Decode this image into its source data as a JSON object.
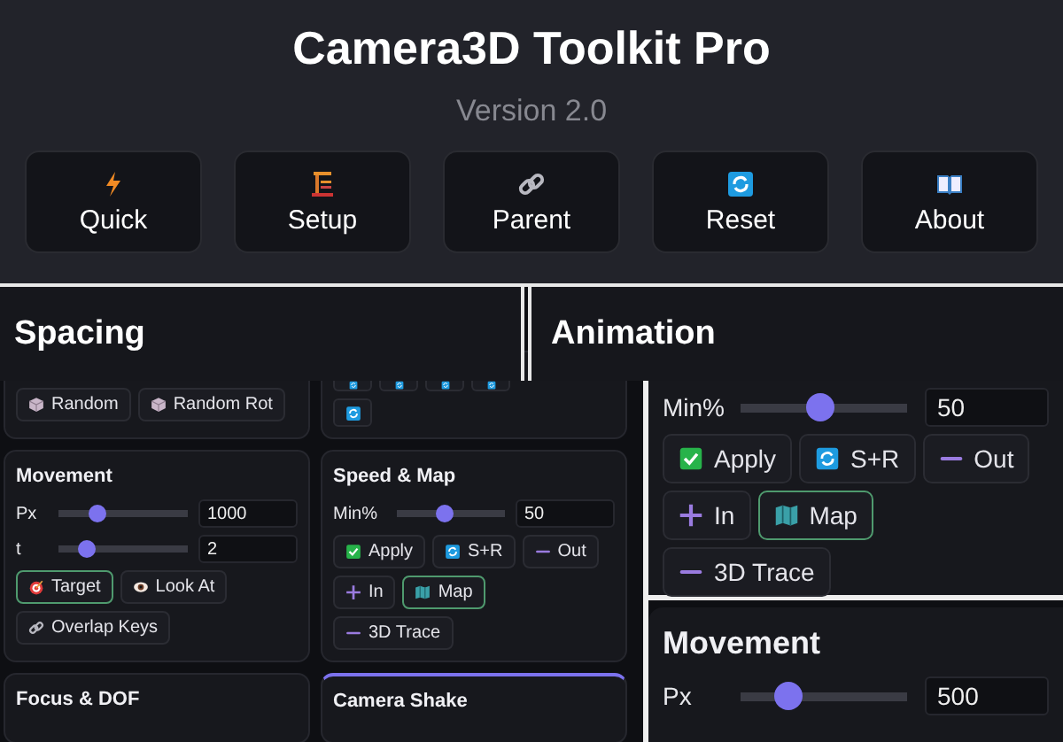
{
  "header": {
    "title": "Camera3D Toolkit Pro",
    "version": "Version 2.0"
  },
  "nav_buttons": [
    {
      "label": "Quick"
    },
    {
      "label": "Setup"
    },
    {
      "label": "Parent"
    },
    {
      "label": "Reset"
    },
    {
      "label": "About"
    }
  ],
  "spacing_banner": {
    "title": "Spacing"
  },
  "animation_banner": {
    "title": "Animation"
  },
  "panel": {
    "random_buttons": [
      "Random",
      "Random Rot"
    ],
    "movement": {
      "title": "Movement",
      "sliders": [
        {
          "label": "Px",
          "level": 0.3,
          "value": "1000"
        },
        {
          "label": "t",
          "level": 0.22,
          "value": "2"
        }
      ],
      "button_rows": [
        [
          {
            "label": "Target",
            "selected": true
          },
          {
            "label": "Look At",
            "selected": false
          }
        ],
        [
          {
            "label": "Overlap Keys",
            "selected": false
          }
        ]
      ]
    },
    "speed_map": {
      "title": "Speed & Map",
      "slider": {
        "label": "Min%",
        "level": 0.45,
        "value": "50"
      },
      "button_rows": [
        [
          {
            "label": "Apply",
            "selected": false
          },
          {
            "label": "S+R",
            "selected": false
          },
          {
            "label": "Out",
            "selected": false
          }
        ],
        [
          {
            "label": "In",
            "selected": false
          },
          {
            "label": "Map",
            "selected": true
          }
        ],
        [
          {
            "label": "3D Trace",
            "selected": false
          }
        ]
      ]
    },
    "focus": {
      "title": "Focus & DOF"
    },
    "shake": {
      "title": "Camera Shake"
    }
  },
  "zoom_view": {
    "slider": {
      "label": "Min%",
      "level": 0.48,
      "value": "50"
    },
    "button_rows": [
      [
        {
          "label": "Apply",
          "selected": false
        },
        {
          "label": "S+R",
          "selected": false
        },
        {
          "label": "Out",
          "selected": false
        }
      ],
      [
        {
          "label": "In",
          "selected": false
        },
        {
          "label": "Map",
          "selected": true
        }
      ],
      [
        {
          "label": "3D Trace",
          "selected": false
        }
      ]
    ],
    "movement": {
      "title": "Movement",
      "slider": {
        "label": "Px",
        "level": 0.29,
        "value": "500"
      }
    }
  }
}
